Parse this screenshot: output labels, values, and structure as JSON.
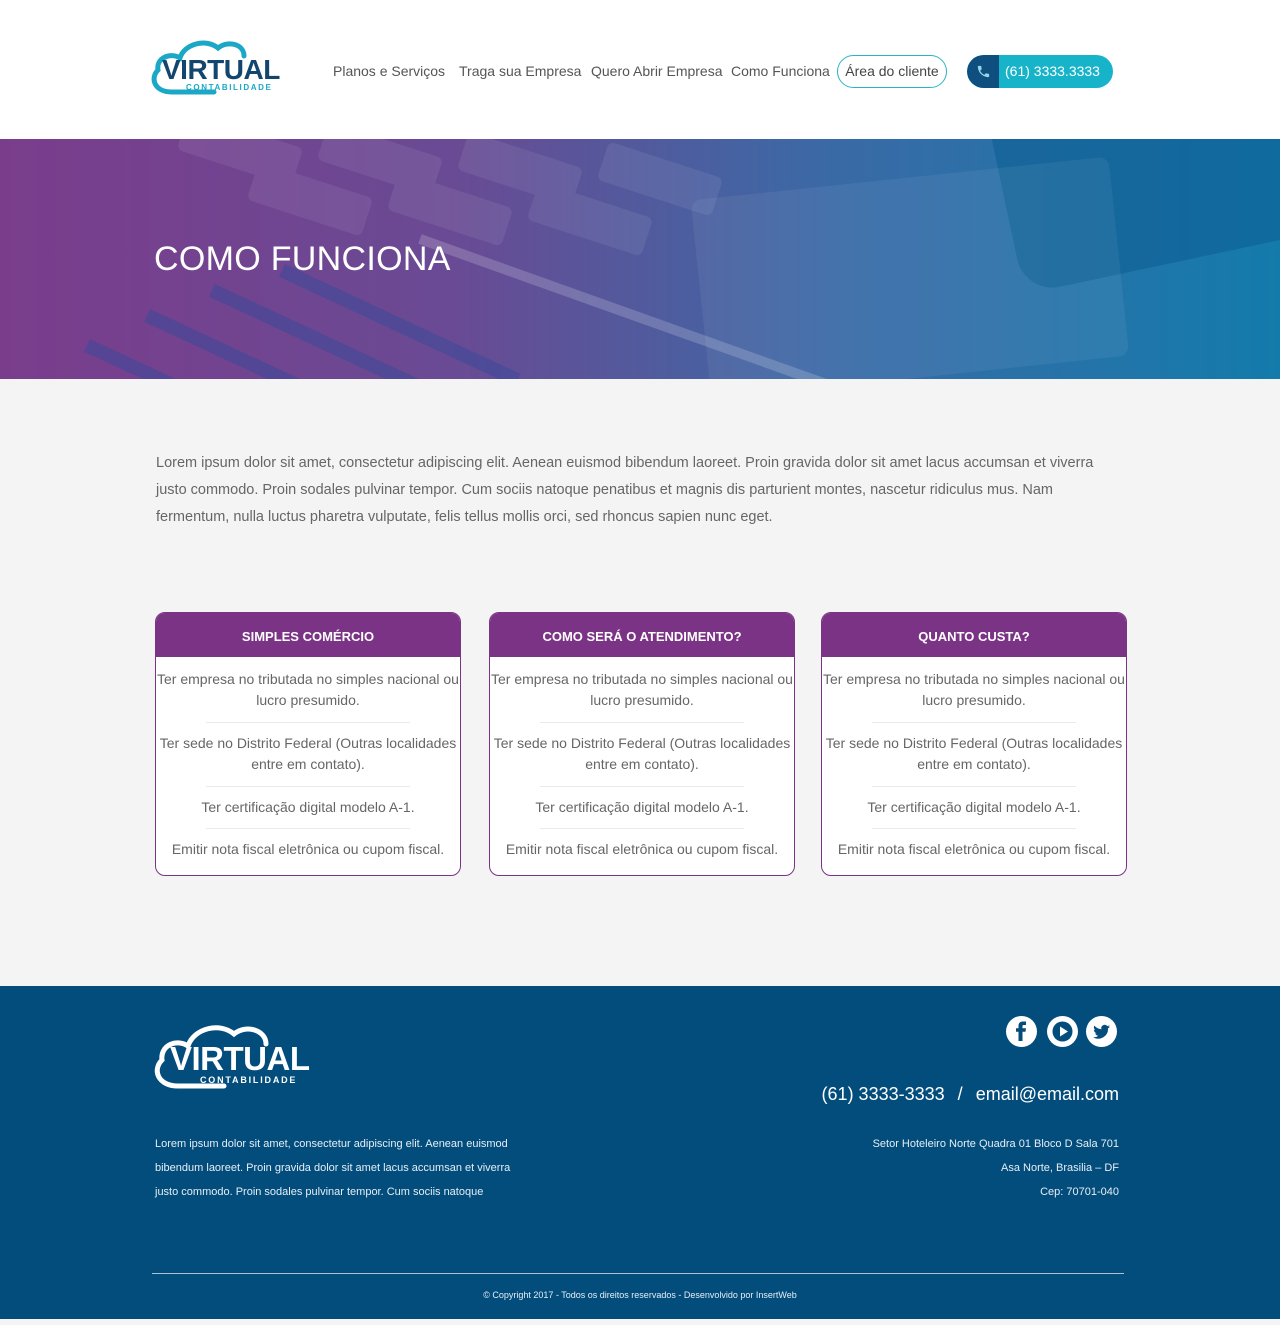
{
  "brand": {
    "name": "VIRTUAL",
    "tagline": "CONTABILIDADE",
    "colors": {
      "primary": "#13466e",
      "accent": "#17b4c9",
      "purple": "#7b3385",
      "footer": "#034d7c"
    }
  },
  "nav": {
    "items": [
      {
        "label": "Planos e Serviços"
      },
      {
        "label": "Traga sua Empresa"
      },
      {
        "label": "Quero Abrir Empresa"
      },
      {
        "label": "Como Funciona"
      }
    ],
    "client_area": "Área do cliente",
    "phone": "(61) 3333.3333",
    "phone_icon": "phone-icon"
  },
  "hero": {
    "title": "COMO FUNCIONA"
  },
  "intro": "Lorem ipsum dolor sit amet, consectetur adipiscing elit. Aenean euismod bibendum laoreet. Proin gravida dolor sit amet lacus accumsan et viverra justo commodo. Proin sodales pulvinar tempor. Cum sociis natoque penatibus et magnis dis parturient montes, nascetur ridiculus mus. Nam fermentum, nulla luctus pharetra vulputate, felis tellus mollis orci, sed rhoncus sapien nunc eget.",
  "cards": [
    {
      "title": "SIMPLES COMÉRCIO",
      "items": [
        "Ter empresa no tributada no simples nacional ou lucro presumido.",
        "Ter sede no Distrito Federal (Outras localidades entre em contato).",
        "Ter certificação digital modelo A-1.",
        "Emitir nota fiscal eletrônica ou cupom fiscal."
      ]
    },
    {
      "title": "COMO SERÁ O ATENDIMENTO?",
      "items": [
        "Ter empresa no tributada no simples nacional ou lucro presumido.",
        "Ter sede no Distrito Federal (Outras localidades entre em contato).",
        "Ter certificação digital modelo A-1.",
        "Emitir nota fiscal eletrônica ou cupom fiscal."
      ]
    },
    {
      "title": "QUANTO CUSTA?",
      "items": [
        "Ter empresa no tributada no simples nacional ou lucro presumido.",
        "Ter sede no Distrito Federal (Outras localidades entre em contato).",
        "Ter certificação digital modelo A-1.",
        "Emitir nota fiscal eletrônica ou cupom fiscal."
      ]
    }
  ],
  "footer": {
    "about": "Lorem ipsum dolor sit amet, consectetur adipiscing elit. Aenean euismod bibendum laoreet. Proin gravida dolor sit amet lacus accumsan et viverra justo commodo. Proin sodales pulvinar tempor. Cum sociis natoque",
    "socials": [
      {
        "icon": "facebook-icon"
      },
      {
        "icon": "youtube-icon"
      },
      {
        "icon": "twitter-icon"
      }
    ],
    "phone": "(61) 3333-3333",
    "separator": "/",
    "email": "email@email.com",
    "address": [
      "Setor Hoteleiro Norte Quadra 01 Bloco D Sala 701",
      "Asa Norte, Brasilia – DF",
      "Cep: 70701-040"
    ],
    "copyright": "© Copyright 2017 - Todos os direitos reservados - Desenvolvido por InsertWeb"
  }
}
